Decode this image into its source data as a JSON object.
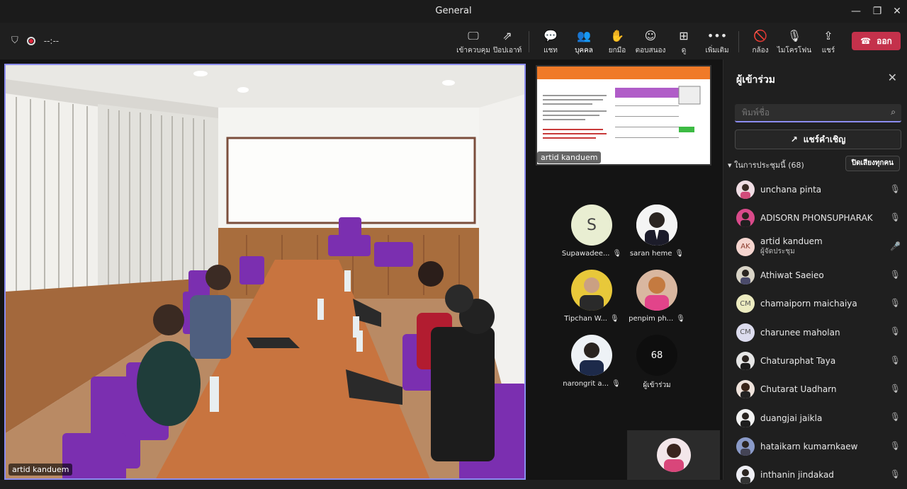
{
  "window": {
    "title": "General",
    "minimize_icon": "minimize-icon",
    "restore_icon": "restore-icon",
    "close_icon": "close-icon"
  },
  "toolbar": {
    "timer": "--:--",
    "buttons": [
      {
        "label": "เข้าควบคุม",
        "icon": "take-control-icon"
      },
      {
        "label": "ป๊อปเอาท์",
        "icon": "popout-icon"
      },
      {
        "label": "แชท",
        "icon": "chat-icon"
      },
      {
        "label": "บุคคล",
        "icon": "people-icon"
      },
      {
        "label": "ยกมือ",
        "icon": "raise-hand-icon"
      },
      {
        "label": "ตอบสนอง",
        "icon": "react-icon"
      },
      {
        "label": "ดู",
        "icon": "view-icon"
      },
      {
        "label": "เพิ่มเติม",
        "icon": "more-icon"
      },
      {
        "label": "กล้อง",
        "icon": "camera-off-icon"
      },
      {
        "label": "ไมโครโฟน",
        "icon": "mic-off-icon"
      },
      {
        "label": "แชร์",
        "icon": "share-icon"
      }
    ],
    "leave_label": "ออก",
    "accent": "#8b8cf0",
    "leave_color": "#c4314b"
  },
  "stage": {
    "main_name": "artid kanduem",
    "share_name": "artid kanduem",
    "tiles": [
      {
        "name": "Supawadee...",
        "initial": "S"
      },
      {
        "name": "saran heme"
      },
      {
        "name": "Tipchan W..."
      },
      {
        "name": "penpim ph..."
      },
      {
        "name": "narongrit a..."
      },
      {
        "name": "ผู้เข้าร่วม",
        "count": "68"
      }
    ]
  },
  "panel": {
    "title": "ผู้เข้าร่วม",
    "search_placeholder": "พิมพ์ชื่อ",
    "share_invite": "แชร์คำเชิญ",
    "section": "ในการประชุมนี้ (68)",
    "mute_all": "ปิดเสียงทุกคน",
    "participants": [
      {
        "name": "unchana pinta",
        "muted": true
      },
      {
        "name": "ADISORN PHONSUPHARAK",
        "muted": true
      },
      {
        "name": "artid kanduem",
        "initials": "AK",
        "role": "ผู้จัดประชุม",
        "muted": false
      },
      {
        "name": "Athiwat Saeieo",
        "muted": true
      },
      {
        "name": "chamaiporn maichaiya",
        "initials": "CM",
        "muted": true
      },
      {
        "name": "charunee maholan",
        "initials": "CM",
        "muted": true
      },
      {
        "name": "Chaturaphat Taya",
        "muted": true
      },
      {
        "name": "Chutarat Uadharn",
        "muted": true
      },
      {
        "name": "duangjai jaikla",
        "muted": true
      },
      {
        "name": "hataikarn kumarnkaew",
        "muted": true
      },
      {
        "name": "inthanin jindakad",
        "muted": true
      }
    ]
  }
}
